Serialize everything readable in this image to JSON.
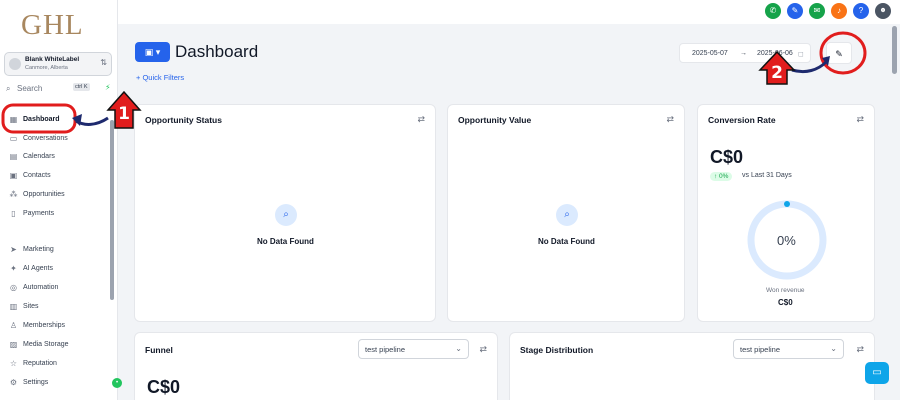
{
  "sidebar": {
    "logo": "GHL",
    "account": {
      "name": "Blank WhiteLabel",
      "location": "Canmore, Alberta"
    },
    "search": {
      "placeholder": "Search",
      "shortcut": "ctrl K"
    },
    "items": [
      {
        "label": "Dashboard",
        "icon": "grid-icon",
        "active": true
      },
      {
        "label": "Conversations",
        "icon": "chat-icon"
      },
      {
        "label": "Calendars",
        "icon": "calendar-icon"
      },
      {
        "label": "Contacts",
        "icon": "contacts-icon"
      },
      {
        "label": "Opportunities",
        "icon": "opportunities-icon"
      },
      {
        "label": "Payments",
        "icon": "payments-icon"
      },
      {
        "label": "Marketing",
        "icon": "send-icon"
      },
      {
        "label": "AI Agents",
        "icon": "sparkle-icon"
      },
      {
        "label": "Automation",
        "icon": "automation-icon"
      },
      {
        "label": "Sites",
        "icon": "sites-icon"
      },
      {
        "label": "Memberships",
        "icon": "award-icon"
      },
      {
        "label": "Media Storage",
        "icon": "image-icon"
      },
      {
        "label": "Reputation",
        "icon": "star-icon"
      },
      {
        "label": "Settings",
        "icon": "gear-icon"
      }
    ]
  },
  "header": {
    "title": "Dashboard",
    "quick_filters": "+ Quick Filters",
    "date_start": "2025-05-07",
    "date_arrow": "→",
    "date_end": "2025-06-06"
  },
  "cards": {
    "opportunity_status": {
      "title": "Opportunity Status",
      "empty": "No Data Found"
    },
    "opportunity_value": {
      "title": "Opportunity Value",
      "empty": "No Data Found"
    },
    "conversion_rate": {
      "title": "Conversion Rate",
      "value": "C$0",
      "change": "↑ 0%",
      "compare": "vs Last 31 Days",
      "ring_percent": "0%",
      "won_label": "Won revenue",
      "won_value": "C$0"
    },
    "funnel": {
      "title": "Funnel",
      "pipeline": "test pipeline",
      "value": "C$0"
    },
    "stage_distribution": {
      "title": "Stage Distribution",
      "pipeline": "test pipeline"
    }
  },
  "annotations": {
    "step1": "1",
    "step2": "2"
  },
  "colors": {
    "primary": "#2563eb",
    "highlight": "#e11d1d",
    "arrow": "#1e2a6e"
  }
}
